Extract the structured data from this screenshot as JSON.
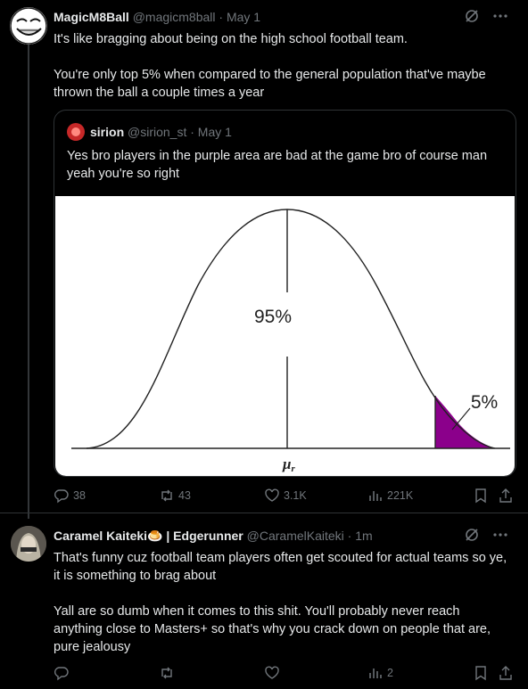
{
  "tweets": [
    {
      "name": "MagicM8Ball",
      "handle": "@magicm8ball",
      "time": "· May 1",
      "paragraphs": [
        "It's like bragging about being on the high school football team.",
        "You're only top 5% when compared to the general population that've maybe thrown the ball a couple times a year"
      ],
      "quote": {
        "name": "sirion",
        "handle": "@sirion_st",
        "time": "· May 1",
        "text": "Yes bro players in the purple area are bad at the game bro of course man yeah you're so right",
        "image": {
          "label_main": "95%",
          "label_tail": "5%",
          "x_label": "μ",
          "x_label_sub": "r",
          "tail_color": "#8b008b"
        }
      },
      "actions": {
        "replies": "38",
        "reposts": "43",
        "likes": "3.1K",
        "views": "221K"
      }
    },
    {
      "name": "Caramel Kaiteki🍮 | Edgerunner",
      "handle": "@CaramelKaiteki",
      "time": "· 1m",
      "paragraphs": [
        "That's funny cuz football team players often get scouted for actual teams so ye, it is something to brag about",
        "Yall are so dumb when it comes to this shit. You'll probably never reach anything close to Masters+ so that's why you crack down on people that are, pure jealousy"
      ],
      "actions": {
        "replies": "",
        "reposts": "",
        "likes": "",
        "views": "2"
      }
    }
  ],
  "icons": [
    "grok-icon",
    "more-icon",
    "reply-icon",
    "repost-icon",
    "like-icon",
    "views-icon",
    "bookmark-icon",
    "share-icon"
  ]
}
